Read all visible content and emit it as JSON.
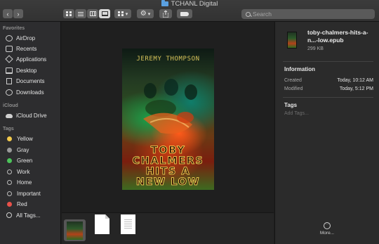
{
  "window": {
    "title": "TCHANL Digital"
  },
  "toolbar": {
    "back_glyph": "‹",
    "forward_glyph": "›",
    "view_modes": [
      "icon-view",
      "list-view",
      "column-view",
      "gallery-view"
    ],
    "selected_view": "gallery-view",
    "group_icon": "grid-icon",
    "action_icon": "gear-icon",
    "chevron": "▾",
    "search": {
      "value": "",
      "placeholder": "Search"
    }
  },
  "sidebar": {
    "favorites_header": "Favorites",
    "favorites": [
      {
        "label": "AirDrop",
        "icon": "airdrop-icon"
      },
      {
        "label": "Recents",
        "icon": "clock-icon"
      },
      {
        "label": "Applications",
        "icon": "applications-icon"
      },
      {
        "label": "Desktop",
        "icon": "desktop-icon"
      },
      {
        "label": "Documents",
        "icon": "document-icon"
      },
      {
        "label": "Downloads",
        "icon": "download-icon"
      }
    ],
    "icloud_header": "iCloud",
    "icloud": [
      {
        "label": "iCloud Drive",
        "icon": "cloud-icon"
      }
    ],
    "tags_header": "Tags",
    "tags": [
      {
        "label": "Yellow",
        "color": "#f2c94c"
      },
      {
        "label": "Gray",
        "color": "#9a9a9a"
      },
      {
        "label": "Green",
        "color": "#4cc35a"
      },
      {
        "label": "Work",
        "color": "#2d2d2f"
      },
      {
        "label": "Home",
        "color": "#2d2d2f"
      },
      {
        "label": "Important",
        "color": "#2d2d2f"
      },
      {
        "label": "Red",
        "color": "#e8514a"
      },
      {
        "label": "All Tags...",
        "color": ""
      }
    ]
  },
  "preview": {
    "cover_author": "JEREMY THOMPSON",
    "cover_title_lines": [
      "TOBY",
      "CHALMERS",
      "HITS A",
      "NEW LOW"
    ]
  },
  "inspector": {
    "file_name": "toby-chalmers-hits-a-n...-low.epub",
    "file_size": "299 KB",
    "information_header": "Information",
    "created_label": "Created",
    "created_value": "Today, 10:12 AM",
    "modified_label": "Modified",
    "modified_value": "Today, 5:12 PM",
    "tags_header": "Tags",
    "tags_placeholder": "Add Tags...",
    "more_label": "More...",
    "more_glyph": "···"
  }
}
